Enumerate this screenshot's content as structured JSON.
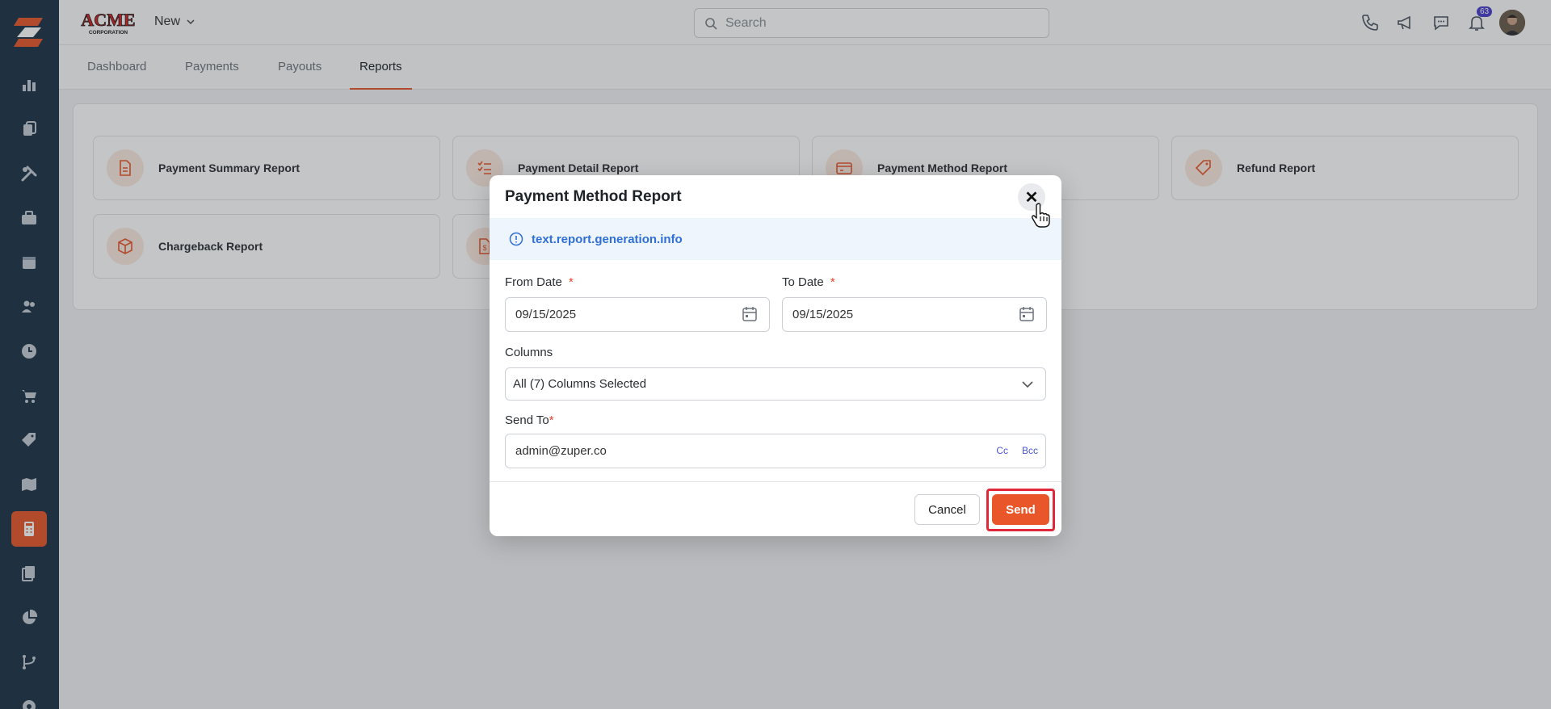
{
  "app": {
    "brand_top": "ACME",
    "brand_bottom": "CORPORATION",
    "new_label": "New",
    "search_placeholder": "Search",
    "notification_count": "63"
  },
  "tabs": [
    {
      "label": "Dashboard"
    },
    {
      "label": "Payments"
    },
    {
      "label": "Payouts"
    },
    {
      "label": "Reports"
    }
  ],
  "report_cards": [
    {
      "label": "Payment Summary Report",
      "icon": "document-icon"
    },
    {
      "label": "Payment Detail Report",
      "icon": "checklist-icon"
    },
    {
      "label": "Payment Method Report",
      "icon": "card-icon"
    },
    {
      "label": "Refund Report",
      "icon": "tag-icon"
    },
    {
      "label": "Chargeback Report",
      "icon": "box-icon"
    },
    {
      "label": "",
      "icon": "dollar-document-icon"
    }
  ],
  "modal": {
    "title": "Payment Method Report",
    "close_symbol": "✕",
    "info_text": "text.report.generation.info",
    "from_date_label": "From Date",
    "from_date_value": "09/15/2025",
    "to_date_label": "To Date",
    "to_date_value": "09/15/2025",
    "required_marker": "*",
    "columns_label": "Columns",
    "columns_value": "All (7) Columns Selected",
    "send_to_label": "Send To",
    "send_to_value": "admin@zuper.co",
    "cc_label": "Cc",
    "bcc_label": "Bcc",
    "cancel_label": "Cancel",
    "send_label": "Send"
  },
  "colors": {
    "accent": "#e8562a",
    "sidebar": "#1d3347",
    "info": "#2f6fd6",
    "highlight": "#e0283a"
  }
}
